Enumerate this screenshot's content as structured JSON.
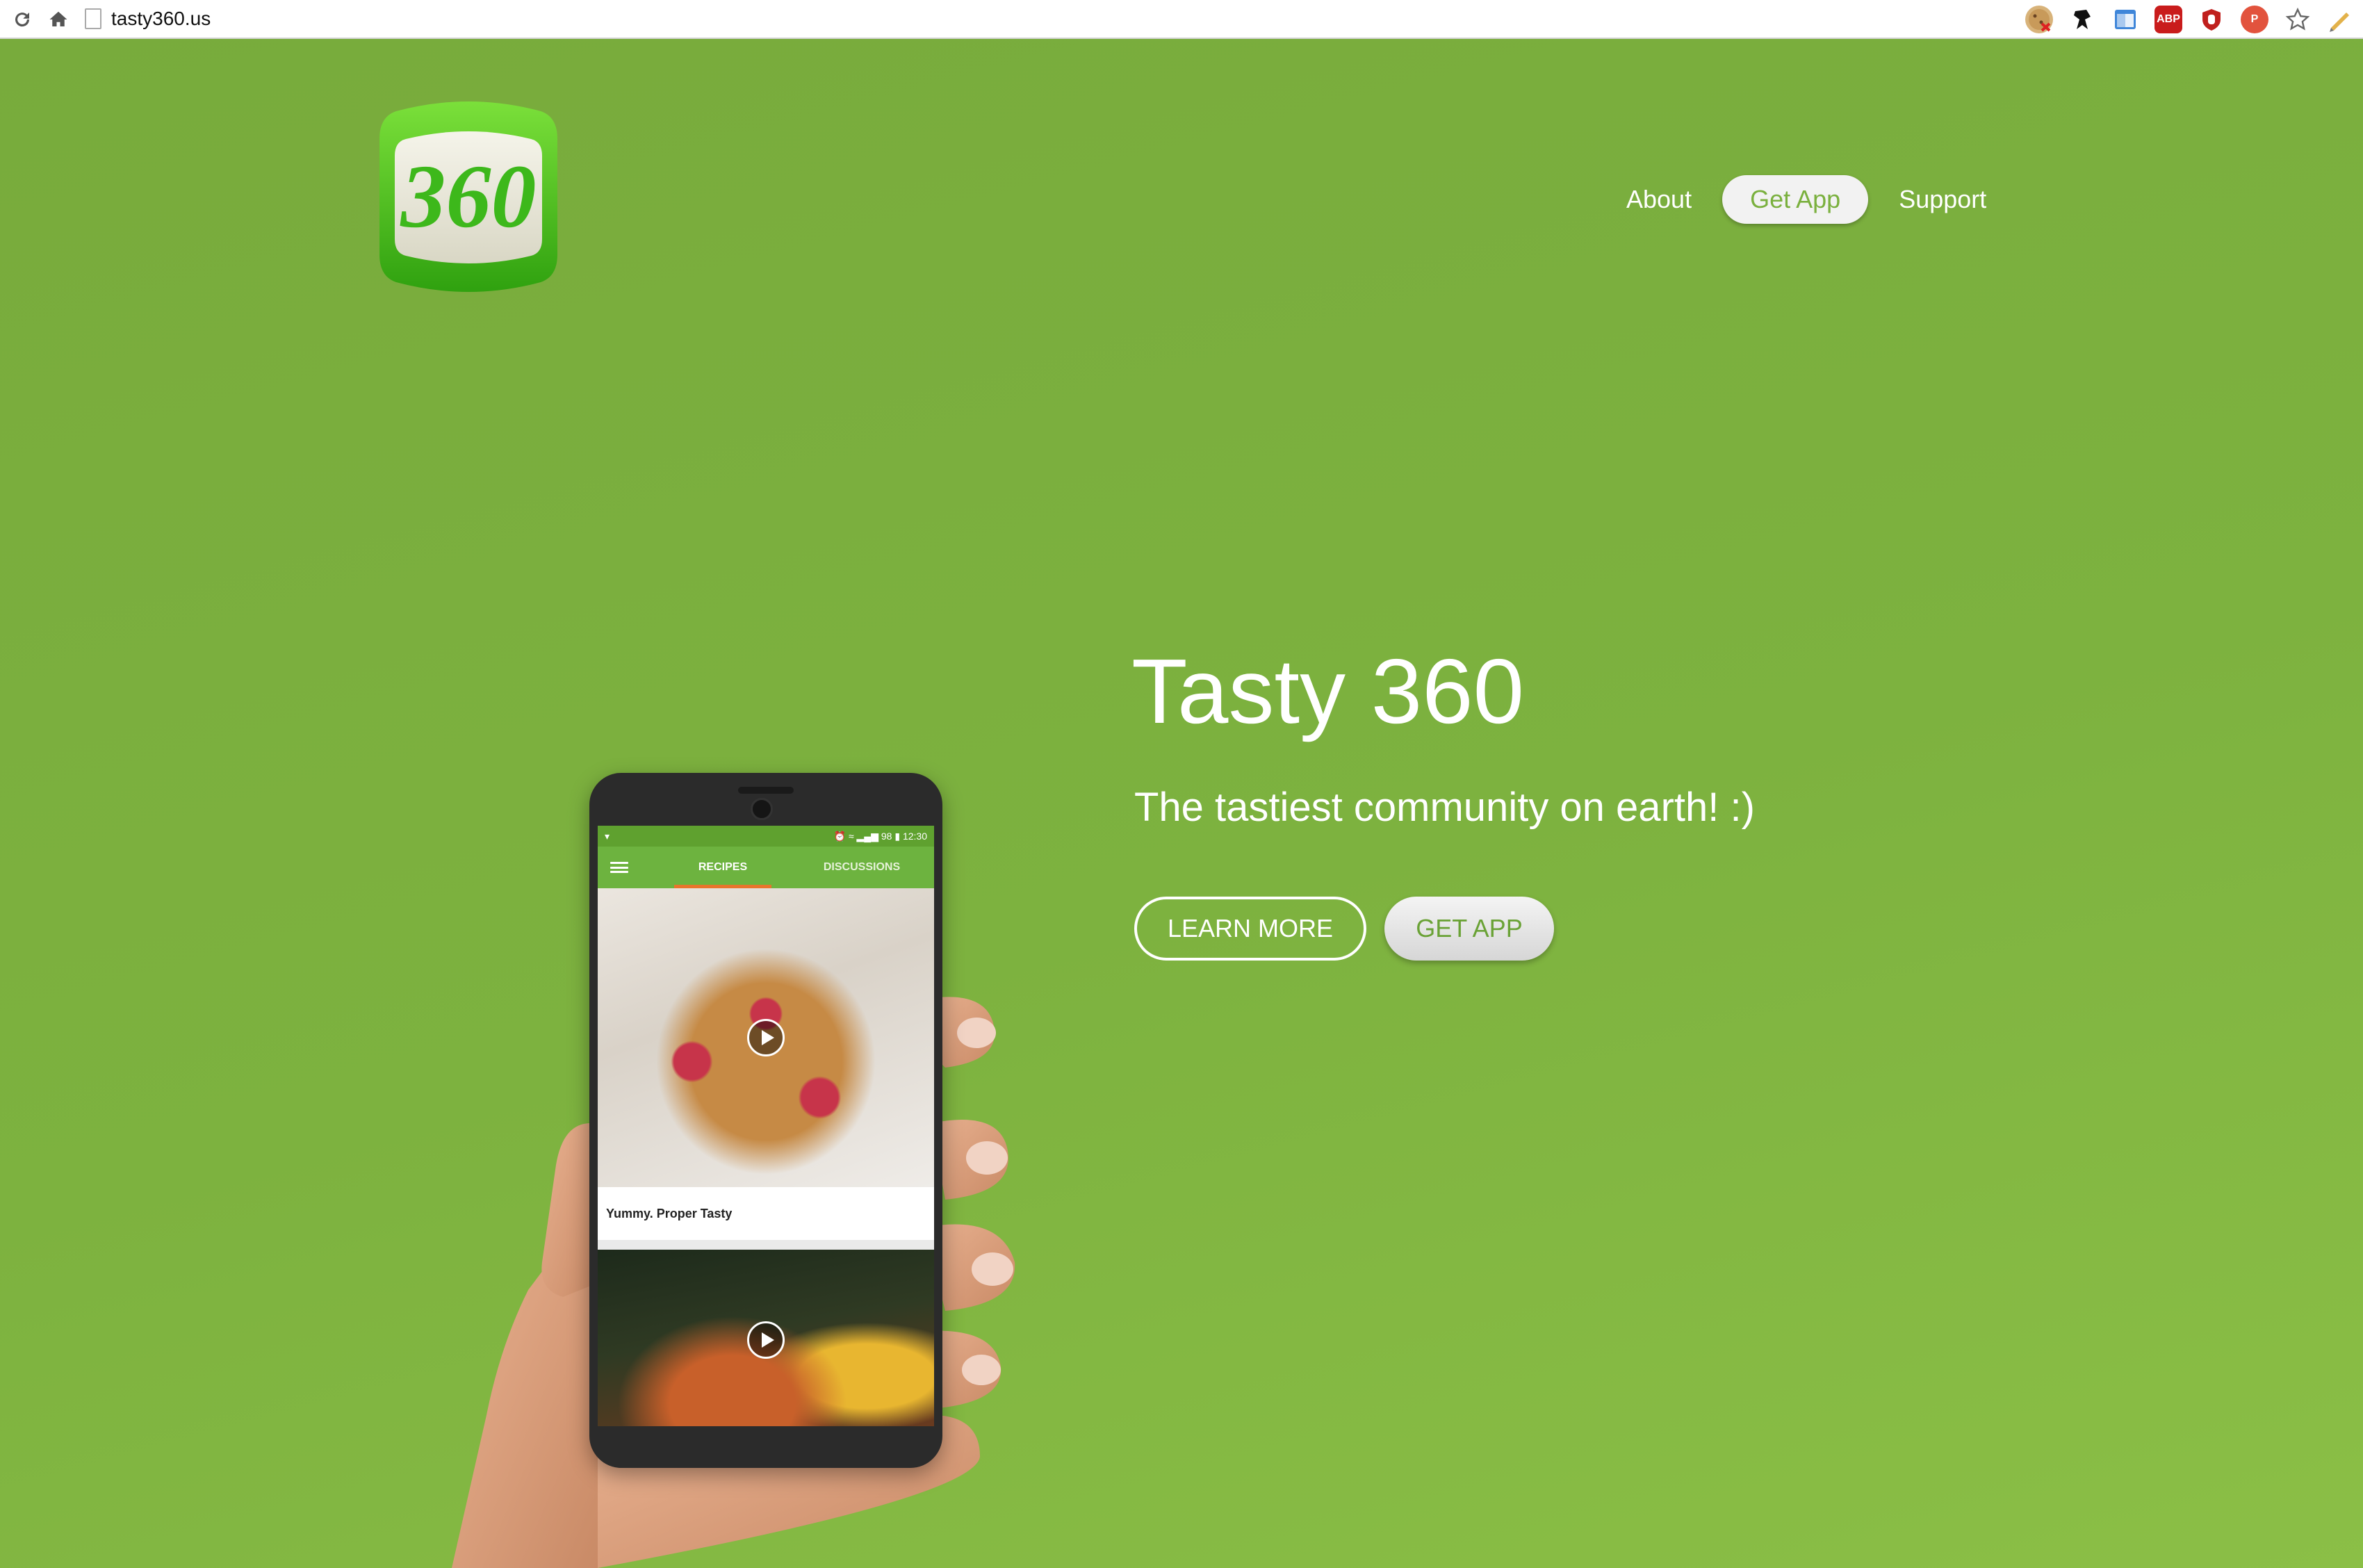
{
  "browser": {
    "url": "tasty360.us",
    "extensions": [
      "cookie-icon",
      "ninja-icon",
      "window-icon",
      "adblock-icon",
      "ublock-icon",
      "pocket-icon",
      "star-icon",
      "edit-icon"
    ],
    "adblock_label": "ABP",
    "pocket_label": "P"
  },
  "logo": {
    "text": "360"
  },
  "nav": {
    "items": [
      {
        "label": "About"
      },
      {
        "label": "Get App",
        "active": true
      },
      {
        "label": "Support"
      }
    ]
  },
  "hero": {
    "title": "Tasty 360",
    "subtitle": "The tastiest community on earth! :)",
    "learn_more_label": "LEARN MORE",
    "get_app_label": "GET APP"
  },
  "phone": {
    "status_time": "12:30",
    "status_battery": "98",
    "tabs": [
      {
        "label": "RECIPES",
        "active": true
      },
      {
        "label": "DISCUSSIONS"
      }
    ],
    "cards": [
      {
        "caption": "Yummy. Proper Tasty"
      }
    ]
  },
  "colors": {
    "background": "#7aae3e",
    "accent_green": "#6db33f",
    "tab_indicator": "#e8752c",
    "button_text": "#6aa236"
  }
}
